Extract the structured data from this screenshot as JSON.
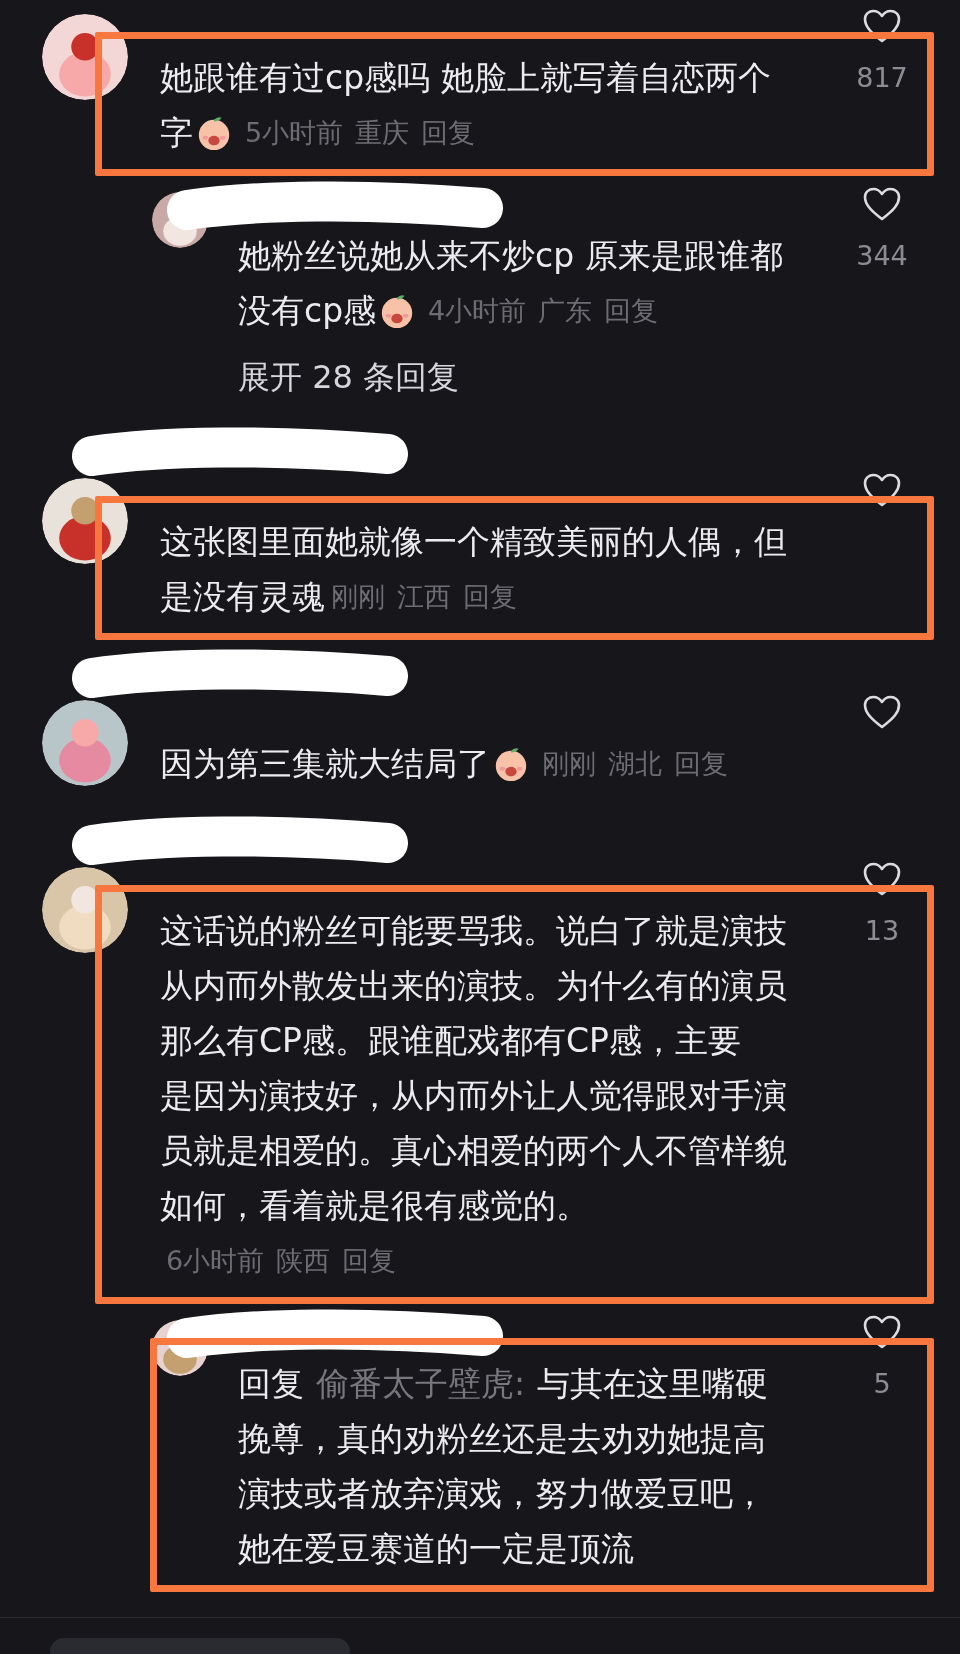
{
  "comments": [
    {
      "kind": "comment",
      "highlighted": true,
      "name_redacted": false,
      "lines": [
        "她跟谁有过cp感吗 她脸上就写着自恋两个",
        "字"
      ],
      "emoji": true,
      "time": "5小时前",
      "location": "重庆",
      "reply_label": "回复",
      "likes": "817"
    },
    {
      "kind": "reply",
      "highlighted": false,
      "name_redacted": true,
      "lines": [
        "她粉丝说她从来不炒cp 原来是跟谁都",
        "没有cp感"
      ],
      "emoji": true,
      "time": "4小时前",
      "location": "广东",
      "reply_label": "回复",
      "likes": "344"
    },
    {
      "kind": "expand",
      "label": "展开 28 条回复"
    },
    {
      "kind": "comment",
      "highlighted": true,
      "name_redacted": true,
      "lines": [
        "这张图里面她就像一个精致美丽的人偶，但",
        "是没有灵魂"
      ],
      "emoji": false,
      "time": "刚刚",
      "location": "江西",
      "reply_label": "回复"
    },
    {
      "kind": "comment",
      "highlighted": false,
      "name_redacted": true,
      "lines": [
        "因为第三集就大结局了"
      ],
      "emoji": true,
      "time": "刚刚",
      "location": "湖北",
      "reply_label": "回复"
    },
    {
      "kind": "comment",
      "highlighted": true,
      "name_redacted": true,
      "lines": [
        "这话说的粉丝可能要骂我。说白了就是演技",
        "从内而外散发出来的演技。为什么有的演员",
        "那么有CP感。跟谁配戏都有CP感，主要",
        "是因为演技好，从内而外让人觉得跟对手演",
        "员就是相爱的。真心相爱的两个人不管样貌",
        "如何，看着就是很有感觉的。"
      ],
      "emoji": false,
      "time": "6小时前",
      "location": "陕西",
      "reply_label": "回复",
      "likes": "13"
    },
    {
      "kind": "reply",
      "highlighted": true,
      "name_redacted": true,
      "reply_prefix": "回复",
      "reply_to": "偷番太子壁虎:",
      "lines": [
        "与其在这里嘴硬",
        "挽尊，真的劝粉丝还是去劝劝她提高",
        "演技或者放弃演戏，努力做爱豆吧，",
        "她在爱豆赛道的一定是顶流"
      ],
      "emoji": false,
      "likes": "5"
    }
  ]
}
